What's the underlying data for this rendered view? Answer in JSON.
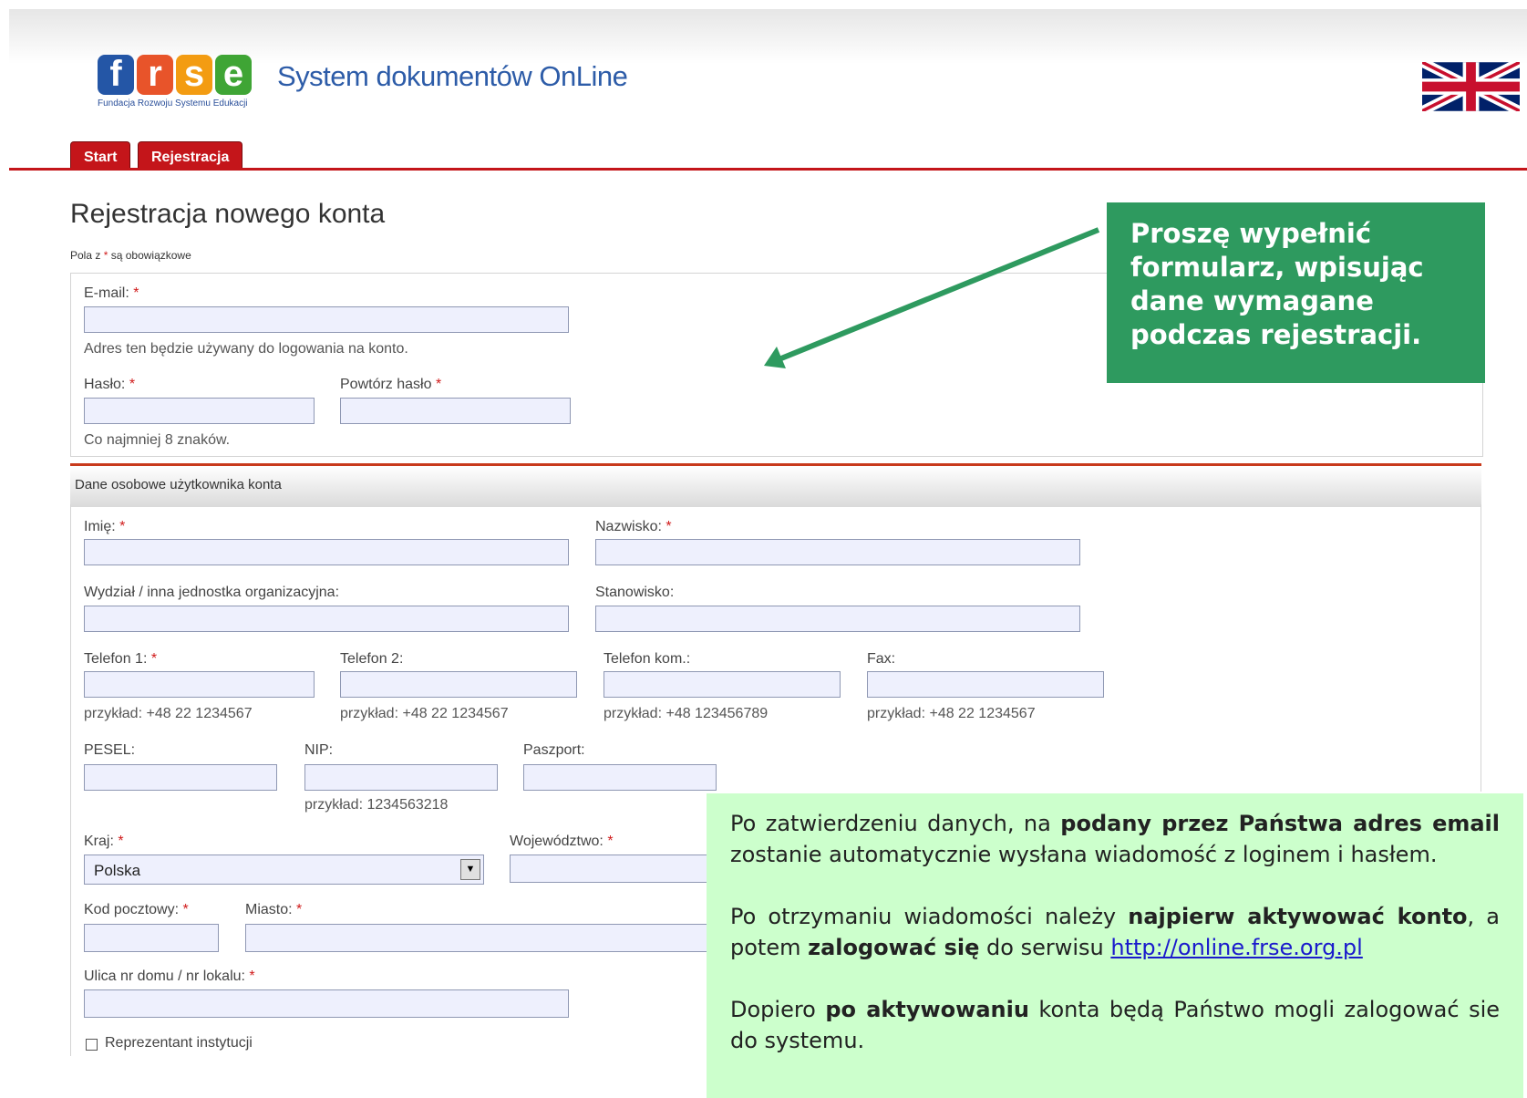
{
  "header": {
    "logo_letters": [
      "f",
      "r",
      "s",
      "e"
    ],
    "logo_colors": [
      "#2456a6",
      "#e8542a",
      "#f39c12",
      "#3fa535"
    ],
    "logo_subtitle": "Fundacja Rozwoju Systemu Edukacji",
    "app_title": "System dokumentów OnLine",
    "language_flag": "uk-flag-icon"
  },
  "tabs": [
    {
      "label": "Start"
    },
    {
      "label": "Rejestracja"
    }
  ],
  "page": {
    "title": "Rejestracja nowego konta",
    "required_note_pre": "Pola z",
    "required_star": "*",
    "required_note_post": "są obowiązkowe"
  },
  "account": {
    "email_label": "E-mail:",
    "email_hint": "Adres ten będzie używany do logowania na konto.",
    "password_label": "Hasło:",
    "password_hint": "Co najmniej 8 znaków.",
    "repeat_password_label": "Powtórz hasło"
  },
  "personal": {
    "section_title": "Dane osobowe użytkownika konta",
    "first_name_label": "Imię:",
    "last_name_label": "Nazwisko:",
    "department_label": "Wydział / inna jednostka organizacyjna:",
    "position_label": "Stanowisko:",
    "phone1_label": "Telefon 1:",
    "phone1_hint": "przykład: +48 22 1234567",
    "phone2_label": "Telefon 2:",
    "phone2_hint": "przykład: +48 22 1234567",
    "mobile_label": "Telefon kom.:",
    "mobile_hint": "przykład: +48 123456789",
    "fax_label": "Fax:",
    "fax_hint": "przykład: +48 22 1234567",
    "pesel_label": "PESEL:",
    "nip_label": "NIP:",
    "nip_hint": "przykład: 1234563218",
    "passport_label": "Paszport:",
    "country_label": "Kraj:",
    "country_value": "Polska",
    "voivodeship_label": "Województwo:",
    "postal_label": "Kod pocztowy:",
    "city_label": "Miasto:",
    "street_label": "Ulica nr domu / nr lokalu:",
    "institution_label": "Reprezentant instytucji",
    "star": "*"
  },
  "callouts": {
    "green_text": "Proszę wypełnić formularz, wpisując dane wymagane podczas rejestracji.",
    "p1_a": "Po zatwierdzeniu danych, na ",
    "p1_b": "podany przez Państwa adres email",
    "p1_c": " zostanie automatycznie wysłana wiadomość z loginem i hasłem.",
    "p2_a": "Po otrzymaniu wiadomości należy ",
    "p2_b": "najpierw aktywować konto",
    "p2_c": ", a potem ",
    "p2_d": "zalogować się",
    "p2_e": " do serwisu ",
    "p2_link": "http://online.frse.org.pl",
    "p3_a": "Dopiero ",
    "p3_b": "po aktywowaniu",
    "p3_c": " konta będą Państwo mogli zalogować sie do systemu."
  },
  "colors": {
    "tab_red": "#c4151a",
    "callout_dark_green": "#2e9a5f",
    "callout_light_green": "#ccffcc",
    "input_bg": "#eef0fd",
    "title_blue": "#2d5ca8"
  }
}
